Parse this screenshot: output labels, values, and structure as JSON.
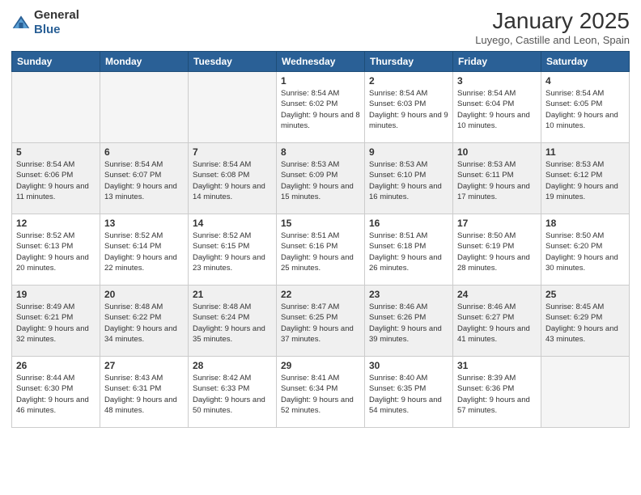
{
  "logo": {
    "general": "General",
    "blue": "Blue"
  },
  "header": {
    "month": "January 2025",
    "location": "Luyego, Castille and Leon, Spain"
  },
  "weekdays": [
    "Sunday",
    "Monday",
    "Tuesday",
    "Wednesday",
    "Thursday",
    "Friday",
    "Saturday"
  ],
  "weeks": [
    [
      {
        "day": "",
        "sunrise": "",
        "sunset": "",
        "daylight": ""
      },
      {
        "day": "",
        "sunrise": "",
        "sunset": "",
        "daylight": ""
      },
      {
        "day": "",
        "sunrise": "",
        "sunset": "",
        "daylight": ""
      },
      {
        "day": "1",
        "sunrise": "Sunrise: 8:54 AM",
        "sunset": "Sunset: 6:02 PM",
        "daylight": "Daylight: 9 hours and 8 minutes."
      },
      {
        "day": "2",
        "sunrise": "Sunrise: 8:54 AM",
        "sunset": "Sunset: 6:03 PM",
        "daylight": "Daylight: 9 hours and 9 minutes."
      },
      {
        "day": "3",
        "sunrise": "Sunrise: 8:54 AM",
        "sunset": "Sunset: 6:04 PM",
        "daylight": "Daylight: 9 hours and 10 minutes."
      },
      {
        "day": "4",
        "sunrise": "Sunrise: 8:54 AM",
        "sunset": "Sunset: 6:05 PM",
        "daylight": "Daylight: 9 hours and 10 minutes."
      }
    ],
    [
      {
        "day": "5",
        "sunrise": "Sunrise: 8:54 AM",
        "sunset": "Sunset: 6:06 PM",
        "daylight": "Daylight: 9 hours and 11 minutes."
      },
      {
        "day": "6",
        "sunrise": "Sunrise: 8:54 AM",
        "sunset": "Sunset: 6:07 PM",
        "daylight": "Daylight: 9 hours and 13 minutes."
      },
      {
        "day": "7",
        "sunrise": "Sunrise: 8:54 AM",
        "sunset": "Sunset: 6:08 PM",
        "daylight": "Daylight: 9 hours and 14 minutes."
      },
      {
        "day": "8",
        "sunrise": "Sunrise: 8:53 AM",
        "sunset": "Sunset: 6:09 PM",
        "daylight": "Daylight: 9 hours and 15 minutes."
      },
      {
        "day": "9",
        "sunrise": "Sunrise: 8:53 AM",
        "sunset": "Sunset: 6:10 PM",
        "daylight": "Daylight: 9 hours and 16 minutes."
      },
      {
        "day": "10",
        "sunrise": "Sunrise: 8:53 AM",
        "sunset": "Sunset: 6:11 PM",
        "daylight": "Daylight: 9 hours and 17 minutes."
      },
      {
        "day": "11",
        "sunrise": "Sunrise: 8:53 AM",
        "sunset": "Sunset: 6:12 PM",
        "daylight": "Daylight: 9 hours and 19 minutes."
      }
    ],
    [
      {
        "day": "12",
        "sunrise": "Sunrise: 8:52 AM",
        "sunset": "Sunset: 6:13 PM",
        "daylight": "Daylight: 9 hours and 20 minutes."
      },
      {
        "day": "13",
        "sunrise": "Sunrise: 8:52 AM",
        "sunset": "Sunset: 6:14 PM",
        "daylight": "Daylight: 9 hours and 22 minutes."
      },
      {
        "day": "14",
        "sunrise": "Sunrise: 8:52 AM",
        "sunset": "Sunset: 6:15 PM",
        "daylight": "Daylight: 9 hours and 23 minutes."
      },
      {
        "day": "15",
        "sunrise": "Sunrise: 8:51 AM",
        "sunset": "Sunset: 6:16 PM",
        "daylight": "Daylight: 9 hours and 25 minutes."
      },
      {
        "day": "16",
        "sunrise": "Sunrise: 8:51 AM",
        "sunset": "Sunset: 6:18 PM",
        "daylight": "Daylight: 9 hours and 26 minutes."
      },
      {
        "day": "17",
        "sunrise": "Sunrise: 8:50 AM",
        "sunset": "Sunset: 6:19 PM",
        "daylight": "Daylight: 9 hours and 28 minutes."
      },
      {
        "day": "18",
        "sunrise": "Sunrise: 8:50 AM",
        "sunset": "Sunset: 6:20 PM",
        "daylight": "Daylight: 9 hours and 30 minutes."
      }
    ],
    [
      {
        "day": "19",
        "sunrise": "Sunrise: 8:49 AM",
        "sunset": "Sunset: 6:21 PM",
        "daylight": "Daylight: 9 hours and 32 minutes."
      },
      {
        "day": "20",
        "sunrise": "Sunrise: 8:48 AM",
        "sunset": "Sunset: 6:22 PM",
        "daylight": "Daylight: 9 hours and 34 minutes."
      },
      {
        "day": "21",
        "sunrise": "Sunrise: 8:48 AM",
        "sunset": "Sunset: 6:24 PM",
        "daylight": "Daylight: 9 hours and 35 minutes."
      },
      {
        "day": "22",
        "sunrise": "Sunrise: 8:47 AM",
        "sunset": "Sunset: 6:25 PM",
        "daylight": "Daylight: 9 hours and 37 minutes."
      },
      {
        "day": "23",
        "sunrise": "Sunrise: 8:46 AM",
        "sunset": "Sunset: 6:26 PM",
        "daylight": "Daylight: 9 hours and 39 minutes."
      },
      {
        "day": "24",
        "sunrise": "Sunrise: 8:46 AM",
        "sunset": "Sunset: 6:27 PM",
        "daylight": "Daylight: 9 hours and 41 minutes."
      },
      {
        "day": "25",
        "sunrise": "Sunrise: 8:45 AM",
        "sunset": "Sunset: 6:29 PM",
        "daylight": "Daylight: 9 hours and 43 minutes."
      }
    ],
    [
      {
        "day": "26",
        "sunrise": "Sunrise: 8:44 AM",
        "sunset": "Sunset: 6:30 PM",
        "daylight": "Daylight: 9 hours and 46 minutes."
      },
      {
        "day": "27",
        "sunrise": "Sunrise: 8:43 AM",
        "sunset": "Sunset: 6:31 PM",
        "daylight": "Daylight: 9 hours and 48 minutes."
      },
      {
        "day": "28",
        "sunrise": "Sunrise: 8:42 AM",
        "sunset": "Sunset: 6:33 PM",
        "daylight": "Daylight: 9 hours and 50 minutes."
      },
      {
        "day": "29",
        "sunrise": "Sunrise: 8:41 AM",
        "sunset": "Sunset: 6:34 PM",
        "daylight": "Daylight: 9 hours and 52 minutes."
      },
      {
        "day": "30",
        "sunrise": "Sunrise: 8:40 AM",
        "sunset": "Sunset: 6:35 PM",
        "daylight": "Daylight: 9 hours and 54 minutes."
      },
      {
        "day": "31",
        "sunrise": "Sunrise: 8:39 AM",
        "sunset": "Sunset: 6:36 PM",
        "daylight": "Daylight: 9 hours and 57 minutes."
      },
      {
        "day": "",
        "sunrise": "",
        "sunset": "",
        "daylight": ""
      }
    ]
  ]
}
